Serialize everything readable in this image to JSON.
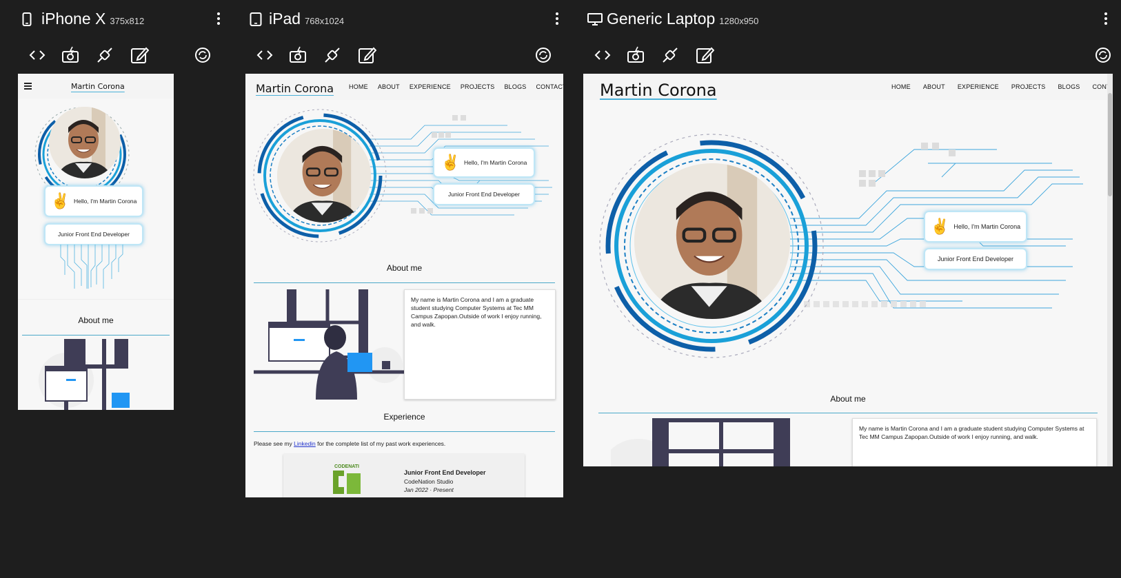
{
  "devices": [
    {
      "name": "iPhone X",
      "size": "375x812",
      "icon": "phone-icon"
    },
    {
      "name": "iPad",
      "size": "768x1024",
      "icon": "tablet-icon"
    },
    {
      "name": "Generic Laptop",
      "size": "1280x950",
      "icon": "monitor-icon"
    }
  ],
  "toolbar_icons": [
    "code-icon",
    "camera-icon",
    "plug-icon",
    "edit-icon",
    "rotate-icon"
  ],
  "site": {
    "brand": "Martin Corona",
    "nav": [
      "HOME",
      "ABOUT",
      "EXPERIENCE",
      "PROJECTS",
      "BLOGS",
      "CONTACT"
    ],
    "greeting": "Hello, I'm Martin Corona",
    "role": "Junior Front End Developer",
    "about_title": "About me",
    "about_text": "My name is Martin Corona and I am a graduate student studying Computer Systems at Tec MM Campus Zapopan.Outside of work I enjoy running, and walk.",
    "experience_title": "Experience",
    "experience_intro_before": "Please see my ",
    "experience_link": "Linkedin",
    "experience_intro_after": " for the complete list of my past work experiences.",
    "job": {
      "title": "Junior Front End Developer",
      "company": "CodeNation Studio",
      "period": "Jan 2022 · Present",
      "logo_text": "CODENATION STUDIO"
    }
  },
  "colors": {
    "bg": "#1e1e1e",
    "accent": "#49a8c8",
    "circuit": "#1b7fc4"
  }
}
